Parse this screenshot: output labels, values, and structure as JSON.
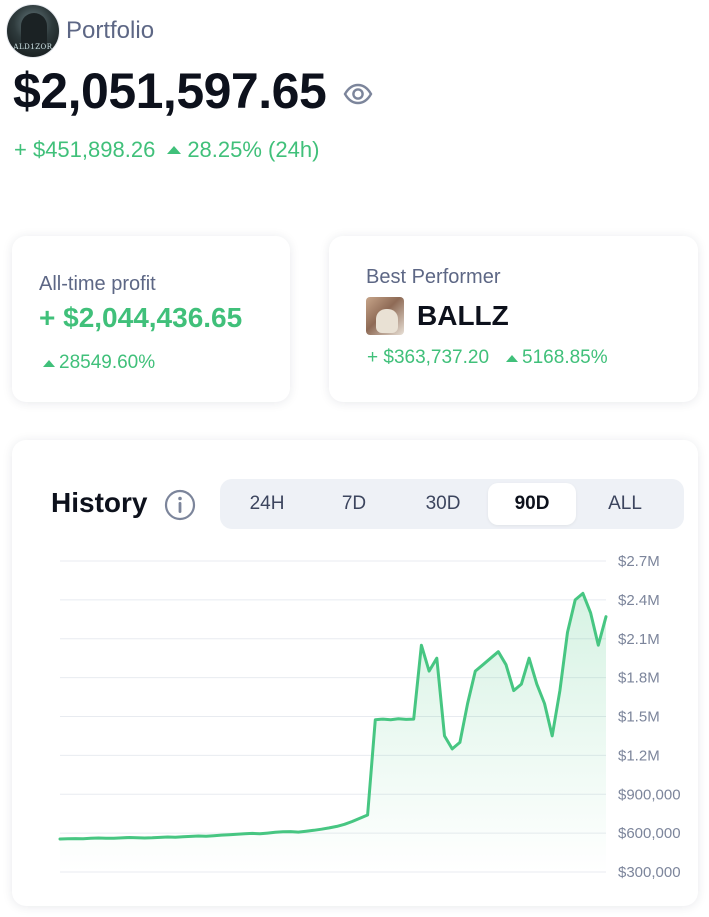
{
  "header": {
    "avatar_text": "ALD1ZOR",
    "portfolio_label": "Portfolio",
    "balance": "$2,051,597.65",
    "eye_icon": "eye-icon",
    "change_amount": "+ $451,898.26",
    "change_pct": "28.25% (24h)"
  },
  "cards": {
    "all_time_profit": {
      "label": "All-time profit",
      "value": "+ $2,044,436.65",
      "pct": "28549.60%"
    },
    "best_performer": {
      "label": "Best Performer",
      "token": "BALLZ",
      "amount": "+ $363,737.20",
      "pct": "5168.85%"
    }
  },
  "history": {
    "title": "History",
    "info_icon": "info-icon",
    "tabs": [
      {
        "label": "24H",
        "active": false
      },
      {
        "label": "7D",
        "active": false
      },
      {
        "label": "30D",
        "active": false
      },
      {
        "label": "90D",
        "active": true
      },
      {
        "label": "ALL",
        "active": false
      }
    ]
  },
  "colors": {
    "positive": "#40c07a",
    "line": "#47c682",
    "muted": "#5d6785",
    "tab_bg": "#eef1f6"
  },
  "chart_data": {
    "type": "line",
    "title": "History",
    "xlabel": "",
    "ylabel": "",
    "ylim": [
      250000,
      2800000
    ],
    "yticks": [
      300000,
      600000,
      900000,
      1200000,
      1500000,
      1800000,
      2100000,
      2400000,
      2700000
    ],
    "ytick_labels": [
      "$300,000",
      "$600,000",
      "$900,000",
      "$1.2M",
      "$1.5M",
      "$1.8M",
      "$2.1M",
      "$2.4M",
      "$2.7M"
    ],
    "grid": true,
    "series": [
      {
        "values": [
          555000,
          556000,
          558000,
          557000,
          560000,
          562000,
          561000,
          560000,
          563000,
          566000,
          565000,
          562000,
          564000,
          567000,
          570000,
          568000,
          572000,
          575000,
          578000,
          576000,
          580000,
          585000,
          588000,
          592000,
          595000,
          598000,
          595000,
          600000,
          606000,
          610000,
          612000,
          608000,
          615000,
          622000,
          630000,
          640000,
          652000,
          668000,
          690000,
          715000,
          740000,
          1475000,
          1480000,
          1475000,
          1482000,
          1478000,
          1480000,
          2050000,
          1850000,
          1950000,
          1350000,
          1250000,
          1300000,
          1600000,
          1850000,
          1900000,
          1950000,
          2000000,
          1900000,
          1700000,
          1750000,
          1950000,
          1750000,
          1600000,
          1350000,
          1700000,
          2150000,
          2400000,
          2450000,
          2300000,
          2050000,
          2270000
        ]
      }
    ]
  }
}
